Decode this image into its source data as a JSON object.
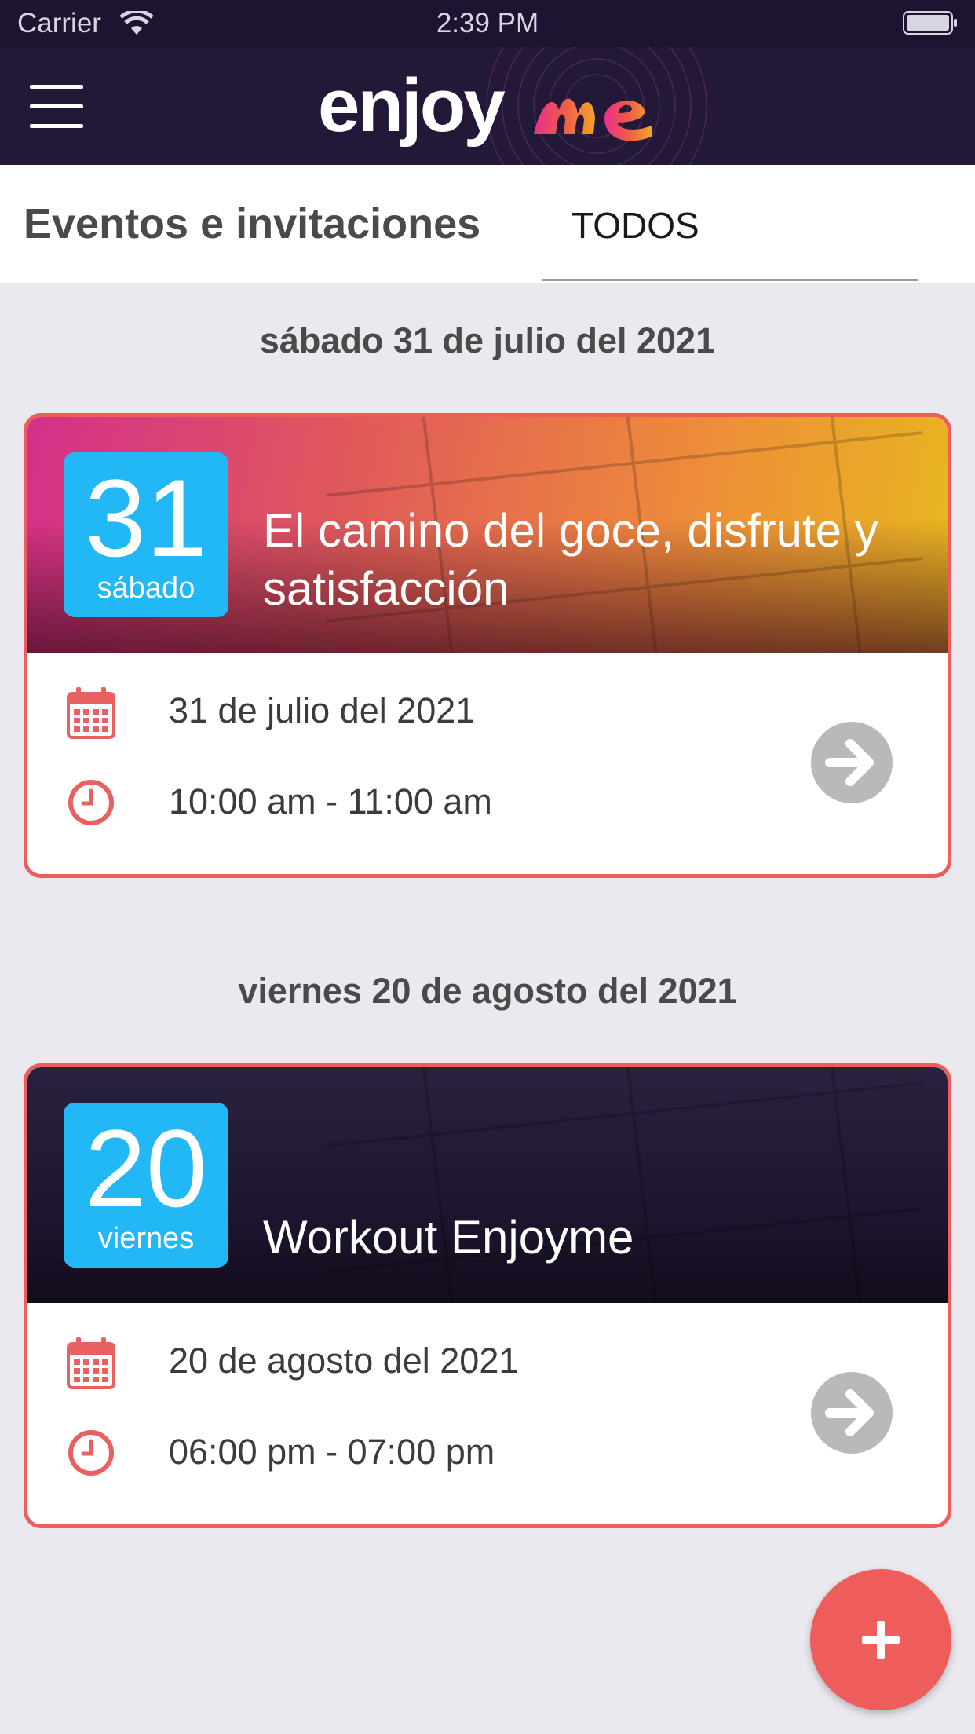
{
  "status_bar": {
    "carrier": "Carrier",
    "time": "2:39 PM"
  },
  "nav": {
    "logo_text": "enjoy",
    "logo_accent": "me"
  },
  "header": {
    "title": "Eventos e invitaciones",
    "tab_label": "TODOS"
  },
  "sections": [
    {
      "date_header": "sábado 31 de julio del 2021",
      "event": {
        "day": "31",
        "weekday": "sábado",
        "title": "El camino del goce, disfrute y satisfacción",
        "date": "31 de julio del 2021",
        "time": "10:00 am - 11:00 am"
      }
    },
    {
      "date_header": "viernes 20 de agosto del 2021",
      "event": {
        "day": "20",
        "weekday": "viernes",
        "title": "Workout Enjoyme",
        "date": "20 de agosto del 2021",
        "time": "06:00 pm - 07:00 pm"
      }
    }
  ],
  "icons": {
    "menu": "hamburger-icon",
    "calendar": "calendar-icon",
    "clock": "clock-icon",
    "arrow": "arrow-right-icon",
    "add": "plus-icon"
  },
  "colors": {
    "nav_background": "#241838",
    "accent_red": "#ee5c5c",
    "badge_blue": "#22b7f5",
    "page_background": "#eae9ef"
  }
}
